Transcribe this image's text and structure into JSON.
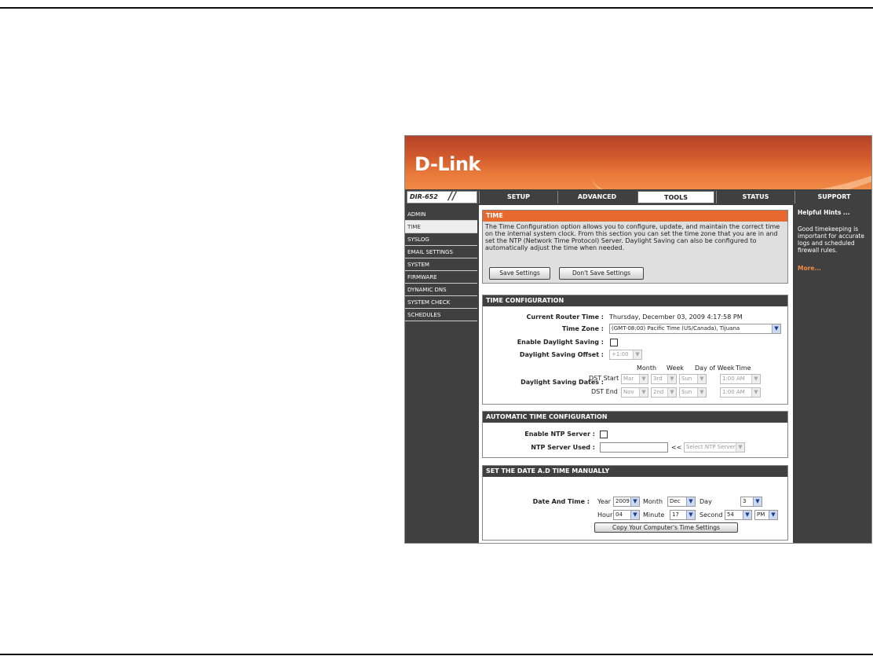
{
  "brand": {
    "logo": "D-Link",
    "model": "DIR-652",
    "slashes": "//"
  },
  "nav_tabs": [
    "SETUP",
    "ADVANCED",
    "TOOLS",
    "STATUS",
    "SUPPORT"
  ],
  "left_nav": [
    "ADMIN",
    "TIME",
    "SYSLOG",
    "EMAIL SETTINGS",
    "SYSTEM",
    "FIRMWARE",
    "DYNAMIC DNS",
    "SYSTEM CHECK",
    "SCHEDULES"
  ],
  "time_section": {
    "title": "TIME",
    "description": "The Time Configuration option allows you to configure, update, and maintain the correct time on the internal system clock. From this section you can set the time zone that you are in and set the NTP (Network Time Protocol) Server. Daylight Saving can also be configured to automatically adjust the time when needed.",
    "save_label": "Save Settings",
    "dont_save_label": "Don't Save Settings"
  },
  "time_config": {
    "title": "TIME CONFIGURATION",
    "current_time_label": "Current Router Time :",
    "current_time_value": "Thursday, December 03, 2009 4:17:58 PM",
    "timezone_label": "Time Zone :",
    "timezone_value": "(GMT-08:00) Pacific Time (US/Canada), Tijuana",
    "dst_enable_label": "Enable Daylight Saving :",
    "dst_offset_label": "Daylight Saving Offset :",
    "dst_offset_value": "+1:00",
    "dst_dates_label": "Daylight Saving Dates :",
    "col_month": "Month",
    "col_week": "Week",
    "col_dow": "Day of Week",
    "col_time": "Time",
    "dst_start_label": "DST Start",
    "dst_end_label": "DST End",
    "start": {
      "month": "Mar",
      "week": "3rd",
      "dow": "Sun",
      "time": "1:00 AM"
    },
    "end": {
      "month": "Nov",
      "week": "2nd",
      "dow": "Sun",
      "time": "1:00 AM"
    }
  },
  "auto_time": {
    "title": "AUTOMATIC TIME CONFIGURATION",
    "ntp_enable_label": "Enable NTP Server :",
    "ntp_used_label": "NTP Server Used :",
    "ntp_arrows": "<<",
    "ntp_select": "Select NTP Server"
  },
  "manual_time": {
    "title": "SET THE DATE A.D TIME MANUALLY",
    "label": "Date And Time :",
    "year_label": "Year",
    "year": "2009",
    "month_label": "Month",
    "month": "Dec",
    "day_label": "Day",
    "day": "3",
    "hour_label": "Hour",
    "hour": "04",
    "minute_label": "Minute",
    "minute": "17",
    "second_label": "Second",
    "second": "54",
    "ampm": "PM",
    "copy_label": "Copy Your Computer's Time Settings"
  },
  "hints": {
    "title": "Helpful Hints ...",
    "body": "Good timekeeping is important for accurate logs and scheduled firewall rules.",
    "more": "More..."
  },
  "colors": {
    "accent": "#e8692e",
    "dark": "#404040"
  }
}
